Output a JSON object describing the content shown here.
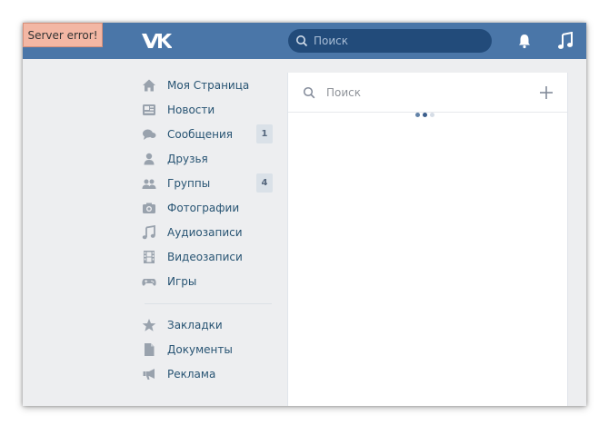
{
  "colors": {
    "header": "#4a76a8",
    "nav_text": "#285473",
    "icon": "#99a2ad",
    "error_bg": "#f3b7a4"
  },
  "error_banner": "Server error!",
  "header": {
    "logo_icon": "vk-logo-icon",
    "search_placeholder": "Поиск",
    "notifications_icon": "bell-icon",
    "music_icon": "music-note-icon"
  },
  "sidebar": {
    "items": [
      {
        "label": "Моя Страница",
        "icon": "home-icon"
      },
      {
        "label": "Новости",
        "icon": "news-icon"
      },
      {
        "label": "Сообщения",
        "icon": "messages-icon",
        "badge": "1"
      },
      {
        "label": "Друзья",
        "icon": "friend-icon"
      },
      {
        "label": "Группы",
        "icon": "groups-icon",
        "badge": "4"
      },
      {
        "label": "Фотографии",
        "icon": "camera-icon"
      },
      {
        "label": "Аудиозаписи",
        "icon": "music-icon"
      },
      {
        "label": "Видеозаписи",
        "icon": "film-icon"
      },
      {
        "label": "Игры",
        "icon": "gamepad-icon"
      }
    ],
    "secondary": [
      {
        "label": "Закладки",
        "icon": "star-icon"
      },
      {
        "label": "Документы",
        "icon": "document-icon"
      },
      {
        "label": "Реклама",
        "icon": "megaphone-icon"
      }
    ]
  },
  "main": {
    "search_placeholder": "Поиск",
    "add_icon": "plus-icon",
    "loading_icon": "loading-dots-icon"
  }
}
